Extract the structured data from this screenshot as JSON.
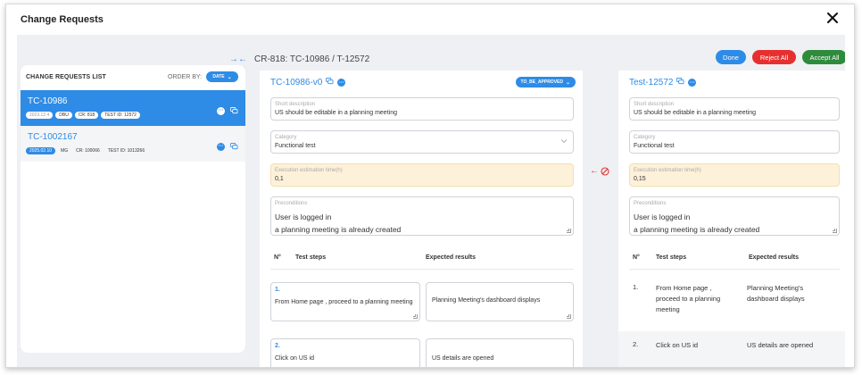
{
  "modal": {
    "title": "Change Requests"
  },
  "list": {
    "title": "CHANGE REQUESTS LIST",
    "order_by": "ORDER BY:",
    "order_value": "DATE",
    "items": [
      {
        "title": "TC-10986",
        "version": "2023.12.4",
        "badges": [
          "DBU",
          "CR: 818",
          "TEST ID: 12572"
        ]
      },
      {
        "title": "TC-1002167",
        "version": "2025.02.10",
        "badges": [
          "MG",
          "CR: 100066",
          "TEST ID: 1013266"
        ]
      }
    ]
  },
  "breadcrumb": "CR-818: TC-10986 / T-12572",
  "actions": {
    "done": "Done",
    "reject_all": "Reject All",
    "accept_all": "Accept All"
  },
  "left_col": {
    "title": "TC-10986-v0",
    "status": "TO_BE_APPROVED",
    "short_description": {
      "label": "Short description",
      "value": "US should be editable in a planning meeting"
    },
    "category": {
      "label": "Category",
      "value": "Functional test"
    },
    "execution": {
      "label": "Execution estimation time(h)",
      "value": "0,1"
    },
    "preconditions": {
      "label": "Preconditions",
      "line1": "User is logged in",
      "line2": "a planning meeting is already created"
    },
    "headers": {
      "num": "N°",
      "steps": "Test steps",
      "expected": "Expected results"
    },
    "steps": [
      {
        "num": "1.",
        "text": "From Home page , proceed to a planning meeting",
        "expected": "Planning Meeting's dashboard displays"
      },
      {
        "num": "2.",
        "text": "Click on US id",
        "expected": "US details are opened"
      }
    ]
  },
  "right_col": {
    "title": "Test-12572",
    "short_description": {
      "label": "Short description",
      "value": "US should be editable in a planning meeting"
    },
    "category": {
      "label": "Category",
      "value": "Functional test"
    },
    "execution": {
      "label": "Execution estimation time(h)",
      "value": "0,15"
    },
    "preconditions": {
      "label": "Preconditions",
      "line1": "User is logged in",
      "line2": "a planning meeting is already created"
    },
    "headers": {
      "num": "N°",
      "steps": "Test steps",
      "expected": "Expected results"
    },
    "steps": [
      {
        "num": "1.",
        "text": "From Home page , proceed to a planning meeting",
        "expected": "Planning Meeting's dashboard displays"
      },
      {
        "num": "2.",
        "text": "Click on US id",
        "expected": "US details are opened"
      }
    ]
  },
  "colors": {
    "accent": "#2e8be6",
    "reject": "#e63030",
    "accept": "#2e8b3c",
    "highlight": "#fdf1d9"
  }
}
